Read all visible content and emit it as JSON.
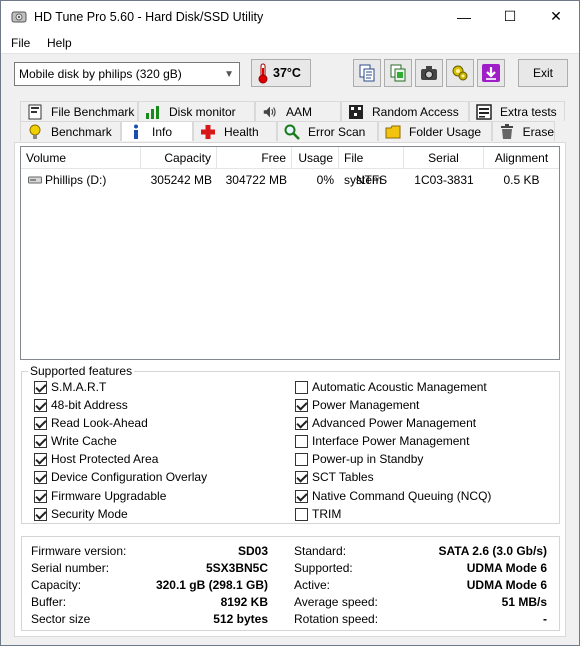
{
  "window": {
    "title": "HD Tune Pro 5.60 - Hard Disk/SSD Utility",
    "controls": {
      "minimize": "—",
      "maximize": "☐",
      "close": "✕"
    }
  },
  "menu": {
    "file": "File",
    "help": "Help"
  },
  "toolbar": {
    "drive": "Mobile  disk by philips (320 gB)",
    "temperature": "37°C",
    "exit_label": "Exit",
    "icons": [
      "copy-text-icon",
      "copy-info-icon",
      "camera-icon",
      "settings-icon",
      "download-icon"
    ]
  },
  "tabs_top": [
    {
      "label": "File Benchmark",
      "icon": "file-benchmark-icon"
    },
    {
      "label": "Disk monitor",
      "icon": "disk-monitor-icon"
    },
    {
      "label": "AAM",
      "icon": "speaker-icon"
    },
    {
      "label": "Random Access",
      "icon": "random-access-icon"
    },
    {
      "label": "Extra tests",
      "icon": "extra-tests-icon"
    }
  ],
  "tabs_bottom": [
    {
      "label": "Benchmark",
      "icon": "benchmark-icon"
    },
    {
      "label": "Info",
      "icon": "info-icon"
    },
    {
      "label": "Health",
      "icon": "health-icon"
    },
    {
      "label": "Error Scan",
      "icon": "error-scan-icon"
    },
    {
      "label": "Folder Usage",
      "icon": "folder-icon"
    },
    {
      "label": "Erase",
      "icon": "erase-icon"
    }
  ],
  "active_tab": "Info",
  "volumes": {
    "columns": [
      "Volume",
      "Capacity",
      "Free",
      "Usage",
      "File system",
      "Serial",
      "Alignment"
    ],
    "rows": [
      {
        "volume": "Phillips (D:)",
        "capacity": "305242 MB",
        "free": "304722 MB",
        "usage": "0%",
        "file_system": "NTFS",
        "serial": "1C03-3831",
        "alignment": "0.5 KB"
      }
    ]
  },
  "features": {
    "legend": "Supported features",
    "left": [
      {
        "label": "S.M.A.R.T",
        "checked": true
      },
      {
        "label": "48-bit Address",
        "checked": true
      },
      {
        "label": "Read Look-Ahead",
        "checked": true
      },
      {
        "label": "Write Cache",
        "checked": true
      },
      {
        "label": "Host Protected Area",
        "checked": true
      },
      {
        "label": "Device Configuration Overlay",
        "checked": true
      },
      {
        "label": "Firmware Upgradable",
        "checked": true
      },
      {
        "label": "Security Mode",
        "checked": true
      }
    ],
    "right": [
      {
        "label": "Automatic Acoustic Management",
        "checked": false
      },
      {
        "label": "Power Management",
        "checked": true
      },
      {
        "label": "Advanced Power Management",
        "checked": true
      },
      {
        "label": "Interface Power Management",
        "checked": false
      },
      {
        "label": "Power-up in Standby",
        "checked": false
      },
      {
        "label": "SCT Tables",
        "checked": true
      },
      {
        "label": "Native Command Queuing (NCQ)",
        "checked": true
      },
      {
        "label": "TRIM",
        "checked": false
      }
    ]
  },
  "details": {
    "left": [
      {
        "label": "Firmware version:",
        "value": "SD03"
      },
      {
        "label": "Serial number:",
        "value": "5SX3BN5C"
      },
      {
        "label": "Capacity:",
        "value": "320.1 gB (298.1 GB)"
      },
      {
        "label": "Buffer:",
        "value": "8192 KB"
      },
      {
        "label": "Sector size",
        "value": "512 bytes"
      }
    ],
    "right": [
      {
        "label": "Standard:",
        "value": "SATA 2.6 (3.0 Gb/s)"
      },
      {
        "label": "Supported:",
        "value": "UDMA Mode 6"
      },
      {
        "label": "Active:",
        "value": "UDMA Mode 6"
      },
      {
        "label": "Average speed:",
        "value": "51 MB/s"
      },
      {
        "label": "Rotation speed:",
        "value": "-"
      }
    ]
  }
}
